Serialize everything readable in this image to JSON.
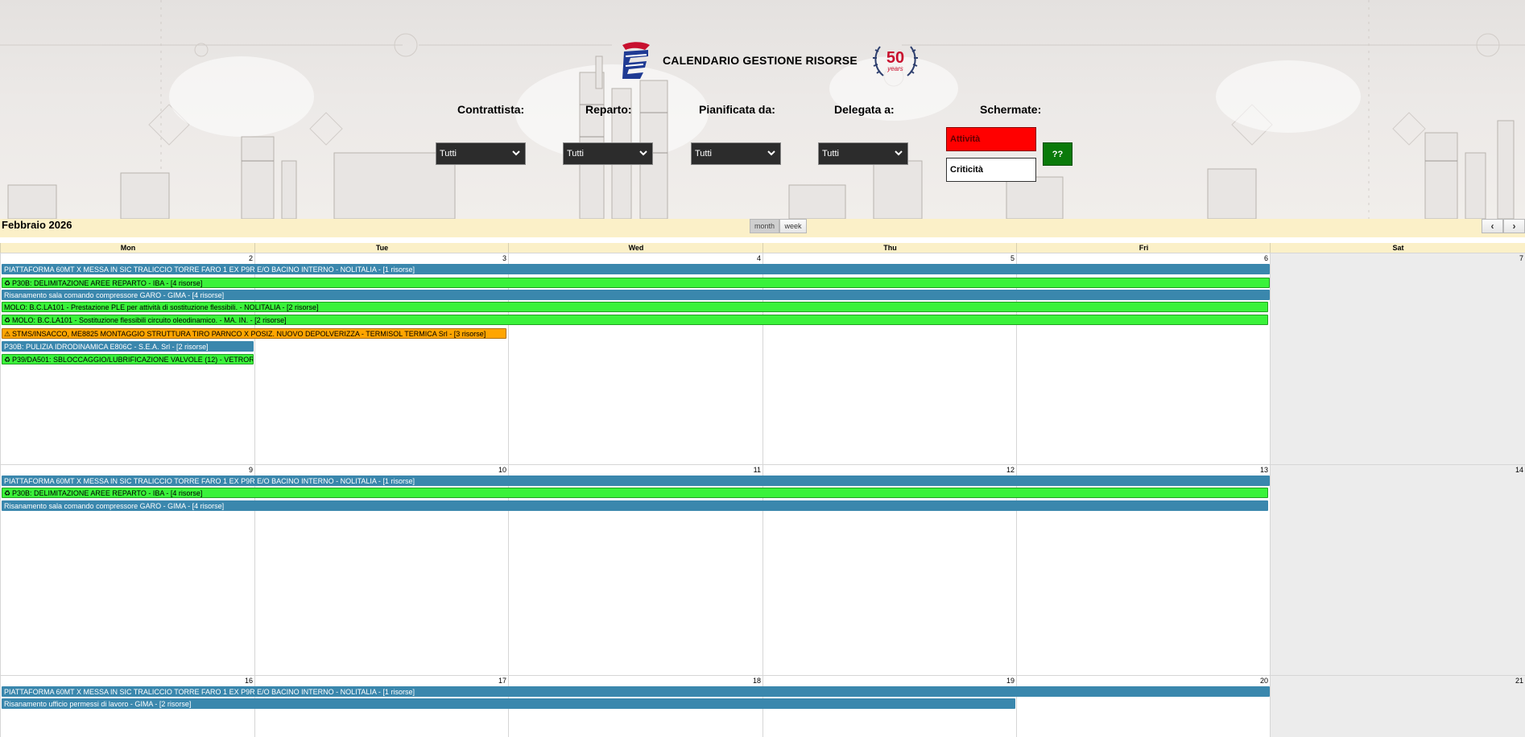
{
  "header": {
    "title": "CALENDARIO GESTIONE RISORSE",
    "seal_number": "50",
    "seal_word": "years"
  },
  "filters": [
    {
      "label": "Contrattista:",
      "value": "Tutti"
    },
    {
      "label": "Reparto:",
      "value": "Tutti"
    },
    {
      "label": "Pianificata da:",
      "value": "Tutti"
    },
    {
      "label": "Delegata a:",
      "value": "Tutti"
    }
  ],
  "schermate": {
    "label": "Schermate:",
    "attivita": "Attività",
    "criticita": "Criticità",
    "help": "??"
  },
  "toolbar": {
    "month_title": "Febbraio 2026",
    "month_btn": "month",
    "week_btn": "week",
    "prev": "‹",
    "next": "›"
  },
  "days_of_week": [
    "Mon",
    "Tue",
    "Wed",
    "Thu",
    "Fri",
    "Sat"
  ],
  "weeks": [
    {
      "days": [
        "2",
        "3",
        "4",
        "5",
        "6",
        "7"
      ],
      "events": [
        {
          "text": "PIATTAFORMA 60MT X MESSA IN SIC TRALICCIO TORRE FARO 1 EX P9R E/O BACINO INTERNO - NOLITALIA - [1 risorse]",
          "color": "blue",
          "icon": ""
        },
        {
          "text": "P30B: DELIMITAZIONE AREE REPARTO - IBA - [4 risorse]",
          "color": "green",
          "icon": "♻"
        },
        {
          "text": "Risanamento sala comando compressore GARO - GIMA - [4 risorse]",
          "color": "blue",
          "icon": ""
        },
        {
          "text": "MOLO: B.C.LA101 - Prestazione PLE per attività di sostituzione flessibili. - NOLITALIA - [2 risorse]",
          "color": "green",
          "icon": ""
        },
        {
          "text": "MOLO: B.C.LA101 - Sostituzione flessibili circuito oleodinamico. - MA. IN. - [2 risorse]",
          "color": "green",
          "icon": "♻"
        },
        {
          "text": "STMS/INSACCO, ME8825 MONTAGGIO STRUTTURA TIRO PARNCO X POSIZ. NUOVO DEPOLVERIZZA - TERMISOL TERMICA Srl - [3 risorse]",
          "color": "orange",
          "icon": "⚠"
        },
        {
          "text": "P30B: PULIZIA IDRODINAMICA E806C - S.E.A. Srl - [2 risorse]",
          "color": "blue",
          "icon": ""
        },
        {
          "text": "P39/DA501: SBLOCCAGGIO/LUBRIFICAZIONE VALVOLE (12) - VETROR",
          "color": "green",
          "icon": "♻"
        }
      ]
    },
    {
      "days": [
        "9",
        "10",
        "11",
        "12",
        "13",
        "14"
      ],
      "events": [
        {
          "text": "PIATTAFORMA 60MT X MESSA IN SIC TRALICCIO TORRE FARO 1 EX P9R E/O BACINO INTERNO - NOLITALIA - [1 risorse]",
          "color": "blue",
          "icon": ""
        },
        {
          "text": "P30B: DELIMITAZIONE AREE REPARTO - IBA - [4 risorse]",
          "color": "green",
          "icon": "♻"
        },
        {
          "text": "Risanamento sala comando compressore GARO - GIMA - [4 risorse]",
          "color": "blue",
          "icon": ""
        }
      ]
    },
    {
      "days": [
        "16",
        "17",
        "18",
        "19",
        "20",
        "21"
      ],
      "events": [
        {
          "text": "PIATTAFORMA 60MT X MESSA IN SIC TRALICCIO TORRE FARO 1 EX P9R E/O BACINO INTERNO - NOLITALIA - [1 risorse]",
          "color": "blue",
          "icon": ""
        },
        {
          "text": "Risanamento ufficio permessi di lavoro - GIMA - [2 risorse]",
          "color": "blue",
          "icon": ""
        }
      ]
    }
  ],
  "colors": {
    "event_blue": "#3a87ad",
    "event_green": "#3af23a",
    "event_orange": "#ffa500",
    "toolbar_bg": "#fbf0c8",
    "attivita_btn": "#ff0000",
    "help_btn": "#0a7a0a"
  }
}
